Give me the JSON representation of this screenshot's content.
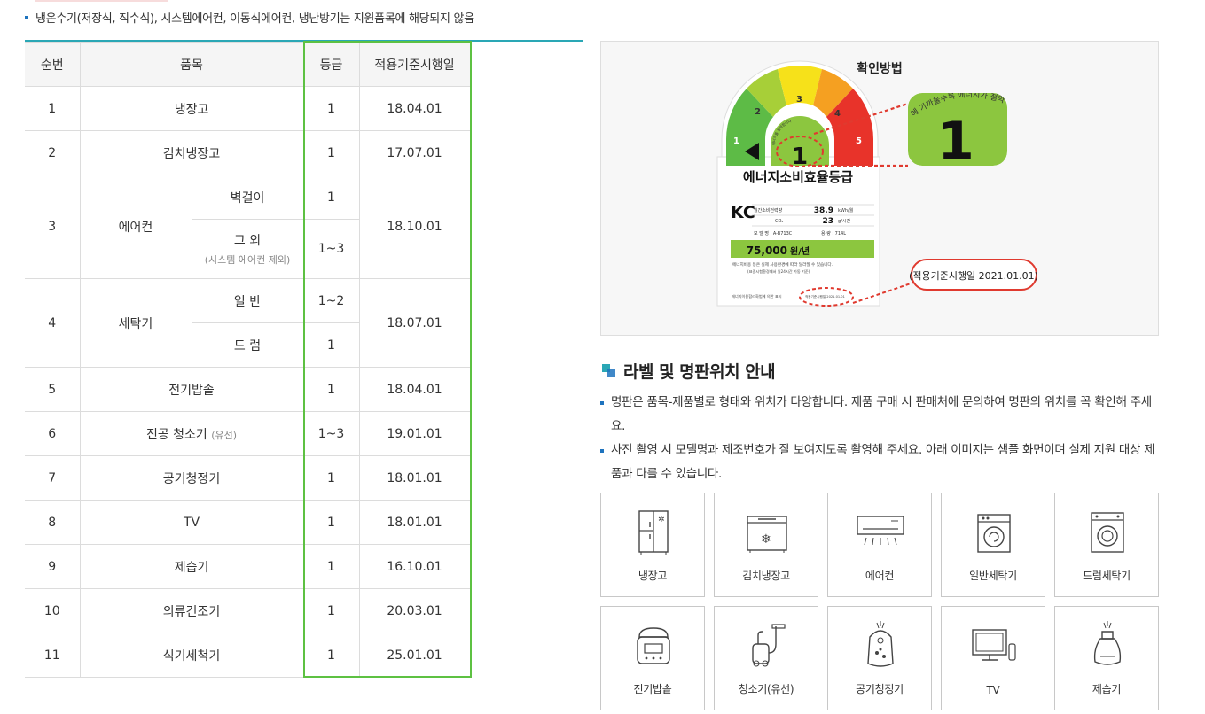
{
  "top_note": "냉온수기(저장식, 직수식), 시스템에어컨, 이동식에어컨, 냉난방기는 지원품목에 해당되지 않음",
  "table": {
    "headers": {
      "no": "순번",
      "item": "품목",
      "grade": "등급",
      "date": "적용기준시행일"
    },
    "rows": {
      "r1": {
        "no": "1",
        "item": "냉장고",
        "grade": "1",
        "date": "18.04.01"
      },
      "r2": {
        "no": "2",
        "item": "김치냉장고",
        "grade": "1",
        "date": "17.07.01"
      },
      "r3": {
        "no": "3",
        "item": "에어컨",
        "sub1": "벽걸이",
        "grade1": "1",
        "sub2": "그 외",
        "sub2_note": "(시스템 에어컨 제외)",
        "grade2": "1~3",
        "date": "18.10.01"
      },
      "r4": {
        "no": "4",
        "item": "세탁기",
        "sub1": "일 반",
        "grade1": "1~2",
        "sub2": "드 럼",
        "grade2": "1",
        "date": "18.07.01"
      },
      "r5": {
        "no": "5",
        "item": "전기밥솥",
        "grade": "1",
        "date": "18.04.01"
      },
      "r6": {
        "no": "6",
        "item": "진공 청소기",
        "item_note": "(유선)",
        "grade": "1~3",
        "date": "19.01.01"
      },
      "r7": {
        "no": "7",
        "item": "공기청정기",
        "grade": "1",
        "date": "18.01.01"
      },
      "r8": {
        "no": "8",
        "item": "TV",
        "grade": "1",
        "date": "18.01.01"
      },
      "r9": {
        "no": "9",
        "item": "제습기",
        "grade": "1",
        "date": "16.10.01"
      },
      "r10": {
        "no": "10",
        "item": "의류건조기",
        "grade": "1",
        "date": "20.03.01"
      },
      "r11": {
        "no": "11",
        "item": "식기세척기",
        "grade": "1",
        "date": "25.01.01"
      }
    }
  },
  "confirm": {
    "title": "확인방법",
    "label": {
      "grade_big": "1",
      "gauge_numbers": [
        "1",
        "2",
        "3",
        "4",
        "5"
      ],
      "arc_text": "에너지를 절약합니다",
      "zoom_arc_text": "에 가까울수록 에너지가 절약",
      "heading": "에너지소비효율등급",
      "kc": "KC",
      "row1_label": "월간소비전력량",
      "row1_value": "38.9",
      "row1_unit": "kWh/월",
      "row2_label": "CO₂",
      "row2_value": "23",
      "row2_unit": "g/시간",
      "model": "모 델 명 : A-B713C",
      "capacity": "용    량 : 714L",
      "cost": "75,000",
      "cost_unit": "원/년",
      "fine1": "에너지비용 등은 실제 사용환경에 따라 달라질 수 있습니다.",
      "fine2": "(표준시험환경에서 일24시간 가동 기준)",
      "footer": "에너지이용합리화법에 의한 표시",
      "footer_date": "적용기준시행일 2021.01.01",
      "callout": "(적용기준시행일 2021.01.01)"
    }
  },
  "section": {
    "title": "라벨 및 명판위치 안내",
    "notes": [
      "명판은 품목-제품별로 형태와 위치가 다양합니다. 제품 구매 시 판매처에 문의하여 명판의 위치를 꼭 확인해 주세요.",
      "사진 촬영 시 모델명과 제조번호가 잘 보여지도록 촬영해 주세요. 아래 이미지는 샘플 화면이며 실제 지원 대상 제품과 다를 수 있습니다."
    ]
  },
  "products": [
    {
      "label": "냉장고",
      "icon": "refrigerator-icon"
    },
    {
      "label": "김치냉장고",
      "icon": "kimchi-refrigerator-icon"
    },
    {
      "label": "에어컨",
      "icon": "air-conditioner-icon"
    },
    {
      "label": "일반세탁기",
      "icon": "top-load-washer-icon"
    },
    {
      "label": "드럼세탁기",
      "icon": "drum-washer-icon"
    },
    {
      "label": "전기밥솥",
      "icon": "rice-cooker-icon"
    },
    {
      "label": "청소기(유선)",
      "icon": "vacuum-cleaner-icon"
    },
    {
      "label": "공기청정기",
      "icon": "air-purifier-icon"
    },
    {
      "label": "TV",
      "icon": "tv-icon"
    },
    {
      "label": "제습기",
      "icon": "dehumidifier-icon"
    }
  ],
  "colors": {
    "accent_green": "#5dc142",
    "teal": "#2aa7b5",
    "blue": "#1e73be",
    "callout_red": "#e03a2f"
  }
}
